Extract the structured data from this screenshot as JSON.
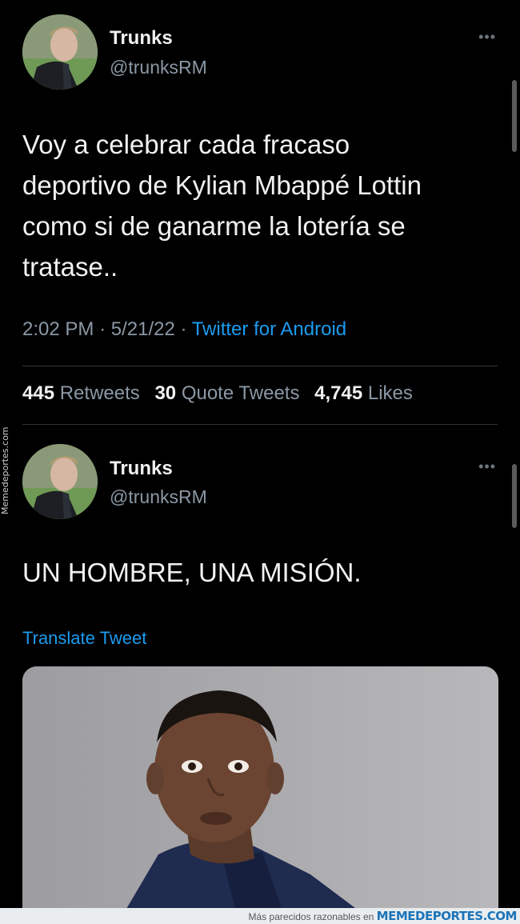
{
  "tweets": [
    {
      "author_name": "Trunks",
      "handle": "@trunksRM",
      "text_lines": [
        "Voy a celebrar cada fracaso",
        "deportivo de Kylian Mbappé Lottin",
        "como si de ganarme la lotería se",
        "tratase.."
      ],
      "time": "2:02 PM",
      "date": "5/21/22",
      "sep": "·",
      "source": "Twitter for Android",
      "stats": {
        "retweets_count": "445",
        "retweets_label": "Retweets",
        "quotes_count": "30",
        "quotes_label": "Quote Tweets",
        "likes_count": "4,745",
        "likes_label": "Likes"
      }
    },
    {
      "author_name": "Trunks",
      "handle": "@trunksRM",
      "text": "UN HOMBRE, UNA MISIÓN.",
      "translate_label": "Translate Tweet"
    }
  ],
  "icons": {
    "more": "more-horizontal-icon"
  },
  "watermark": {
    "side": "Memedeportes.com",
    "footer_text": "Más parecidos razonables en",
    "footer_brand": "MEMEDEPORTES.COM"
  },
  "colors": {
    "background": "#000000",
    "link": "#1d9bf0",
    "muted": "#8b98a5",
    "text": "#f1f1f1"
  }
}
